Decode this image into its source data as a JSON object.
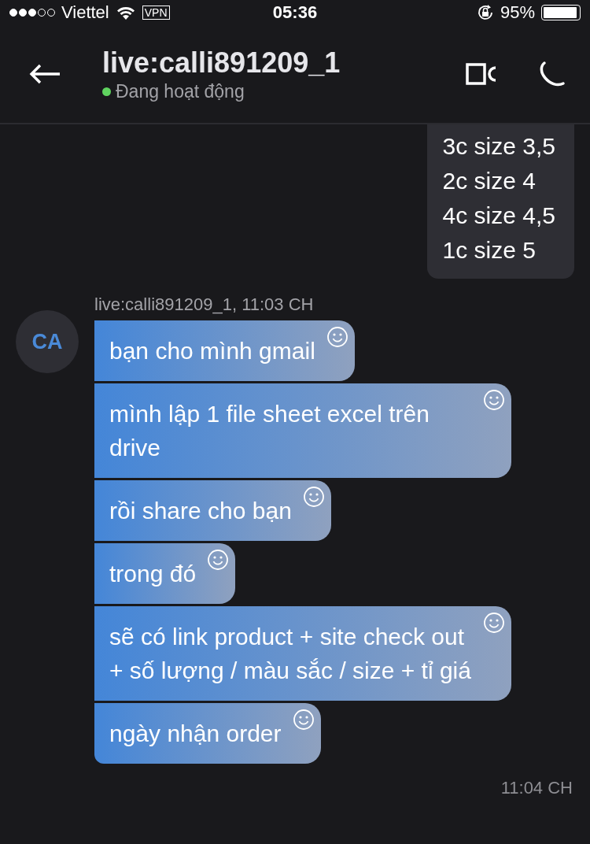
{
  "status_bar": {
    "signal_dots": [
      {
        "filled": true
      },
      {
        "filled": true
      },
      {
        "filled": true
      },
      {
        "filled": false
      },
      {
        "filled": false
      }
    ],
    "carrier": "Viettel",
    "vpn": "VPN",
    "time": "05:36",
    "battery_text": "95%",
    "battery": {
      "level": 0.95
    }
  },
  "header": {
    "title": "live:calli891209_1",
    "status": "Đang hoạt động",
    "online": true
  },
  "outgoing": {
    "lines": [
      "3c size 3,5",
      "2c size 4",
      "4c size 4,5",
      "1c size 5"
    ]
  },
  "incoming": {
    "avatar": "CA",
    "sender": "live:calli891209_1, 11:03 CH",
    "messages": [
      {
        "text": "bạn cho mình gmail"
      },
      {
        "text": "mình lập 1 file sheet excel trên drive"
      },
      {
        "text": "rồi share cho bạn"
      },
      {
        "text": "trong đó"
      },
      {
        "text": "sẽ có link product + site check out + số lượng / màu sắc / size + tỉ giá"
      },
      {
        "text": "ngày nhận order"
      }
    ]
  },
  "next_time": "11:04 CH"
}
